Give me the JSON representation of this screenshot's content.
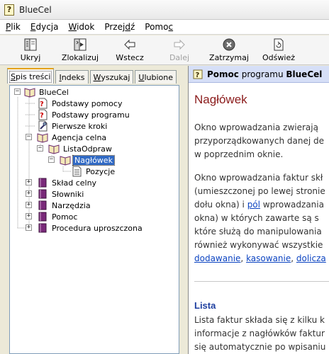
{
  "window": {
    "title": "BlueCel"
  },
  "menu": [
    {
      "label_u": "P",
      "label_rest": "lik"
    },
    {
      "label_u": "E",
      "label_rest": "dycja"
    },
    {
      "label_u": "W",
      "label_rest": "idok"
    },
    {
      "label_pre": "Przej",
      "label_u": "d",
      "label_rest": "ź"
    },
    {
      "label_pre": "Pomo",
      "label_u": "c",
      "label_rest": ""
    }
  ],
  "toolbar": {
    "hide": "Ukryj",
    "locate": "Zlokalizuj",
    "back": "Wstecz",
    "forward": "Dalej",
    "stop": "Zatrzymaj",
    "refresh": "Odśwież"
  },
  "tabs": [
    {
      "u": "S",
      "rest": "pis treści"
    },
    {
      "u": "I",
      "rest": "ndeks"
    },
    {
      "u": "W",
      "rest": "yszukaj"
    },
    {
      "u": "U",
      "rest": "lubione"
    }
  ],
  "tree": {
    "root": "BlueCel",
    "items": [
      "Podstawy pomocy",
      "Podstawy programu",
      "Pierwsze kroki",
      "Agencja celna",
      "ListaOdpraw",
      "Nagłówek",
      "Pozycje",
      "Skład celny",
      "Słowniki",
      "Narzędzia",
      "Pomoc",
      "Procedura uproszczona"
    ]
  },
  "help": {
    "header_bold1": "Pomoc",
    "header_mid": " programu ",
    "header_bold2": "BlueCel",
    "title": "Nagłówek",
    "p1_l1": "Okno wprowadzania zwierają",
    "p1_l2": "przyporządkowanych danej de",
    "p1_l3": "w poprzednim oknie.",
    "p2_l1": "Okno wprowadzania faktur skł",
    "p2_l2": "(umieszczonej po lewej stronie",
    "p2_l3a": "dołu okna) i ",
    "p2_link1": "pól",
    "p2_l3b": " wprowadzania",
    "p2_l4": "okna)  w których zawarte są s",
    "p2_l5": "które służą do manipulowania",
    "p2_l6": "również wykonywać wszystkie",
    "p2_link2": "dodawanie",
    "p2_sep1": ", ",
    "p2_link3": "kasowanie",
    "p2_sep2": ", ",
    "p2_link4": "dolicza",
    "section": "Lista",
    "p3_l1": "Lista faktur składa się z kilku k",
    "p3_l2": "informacje z nagłówków faktur",
    "p3_l3": "się automatycznie po wpisaniu"
  },
  "colors": {
    "title_red": "#8b1b1b",
    "link_blue": "#0b43c1",
    "section_blue": "#1d3e9f",
    "header_bg": "#d6dff7",
    "selected_bg": "#316ac5"
  }
}
